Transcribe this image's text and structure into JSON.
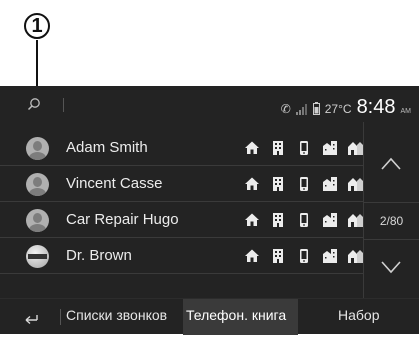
{
  "callout": {
    "number": "1"
  },
  "status_bar": {
    "temperature": "27°C",
    "time": "8:48",
    "ampm": "AM"
  },
  "contacts": [
    {
      "name": "Adam Smith",
      "avatar": "person-silhouette"
    },
    {
      "name": "Vincent Casse",
      "avatar": "person-silhouette"
    },
    {
      "name": "Car Repair Hugo",
      "avatar": "person-silhouette"
    },
    {
      "name": "Dr. Brown",
      "avatar": "nissan-logo"
    }
  ],
  "phone_type_icons": [
    "home-phone-icon",
    "office-phone-icon",
    "mobile-phone-icon",
    "work-building-icon",
    "other-building-icon"
  ],
  "pagination": {
    "page_indicator": "2/80"
  },
  "tabs": [
    {
      "label": "Списки звонков",
      "active": false
    },
    {
      "label": "Телефон. книга",
      "active": true
    },
    {
      "label": "Набор",
      "active": false
    }
  ],
  "colors": {
    "screen_bg": "#232323",
    "active_tab_bg": "#3a3a3a",
    "text": "#ececec"
  }
}
